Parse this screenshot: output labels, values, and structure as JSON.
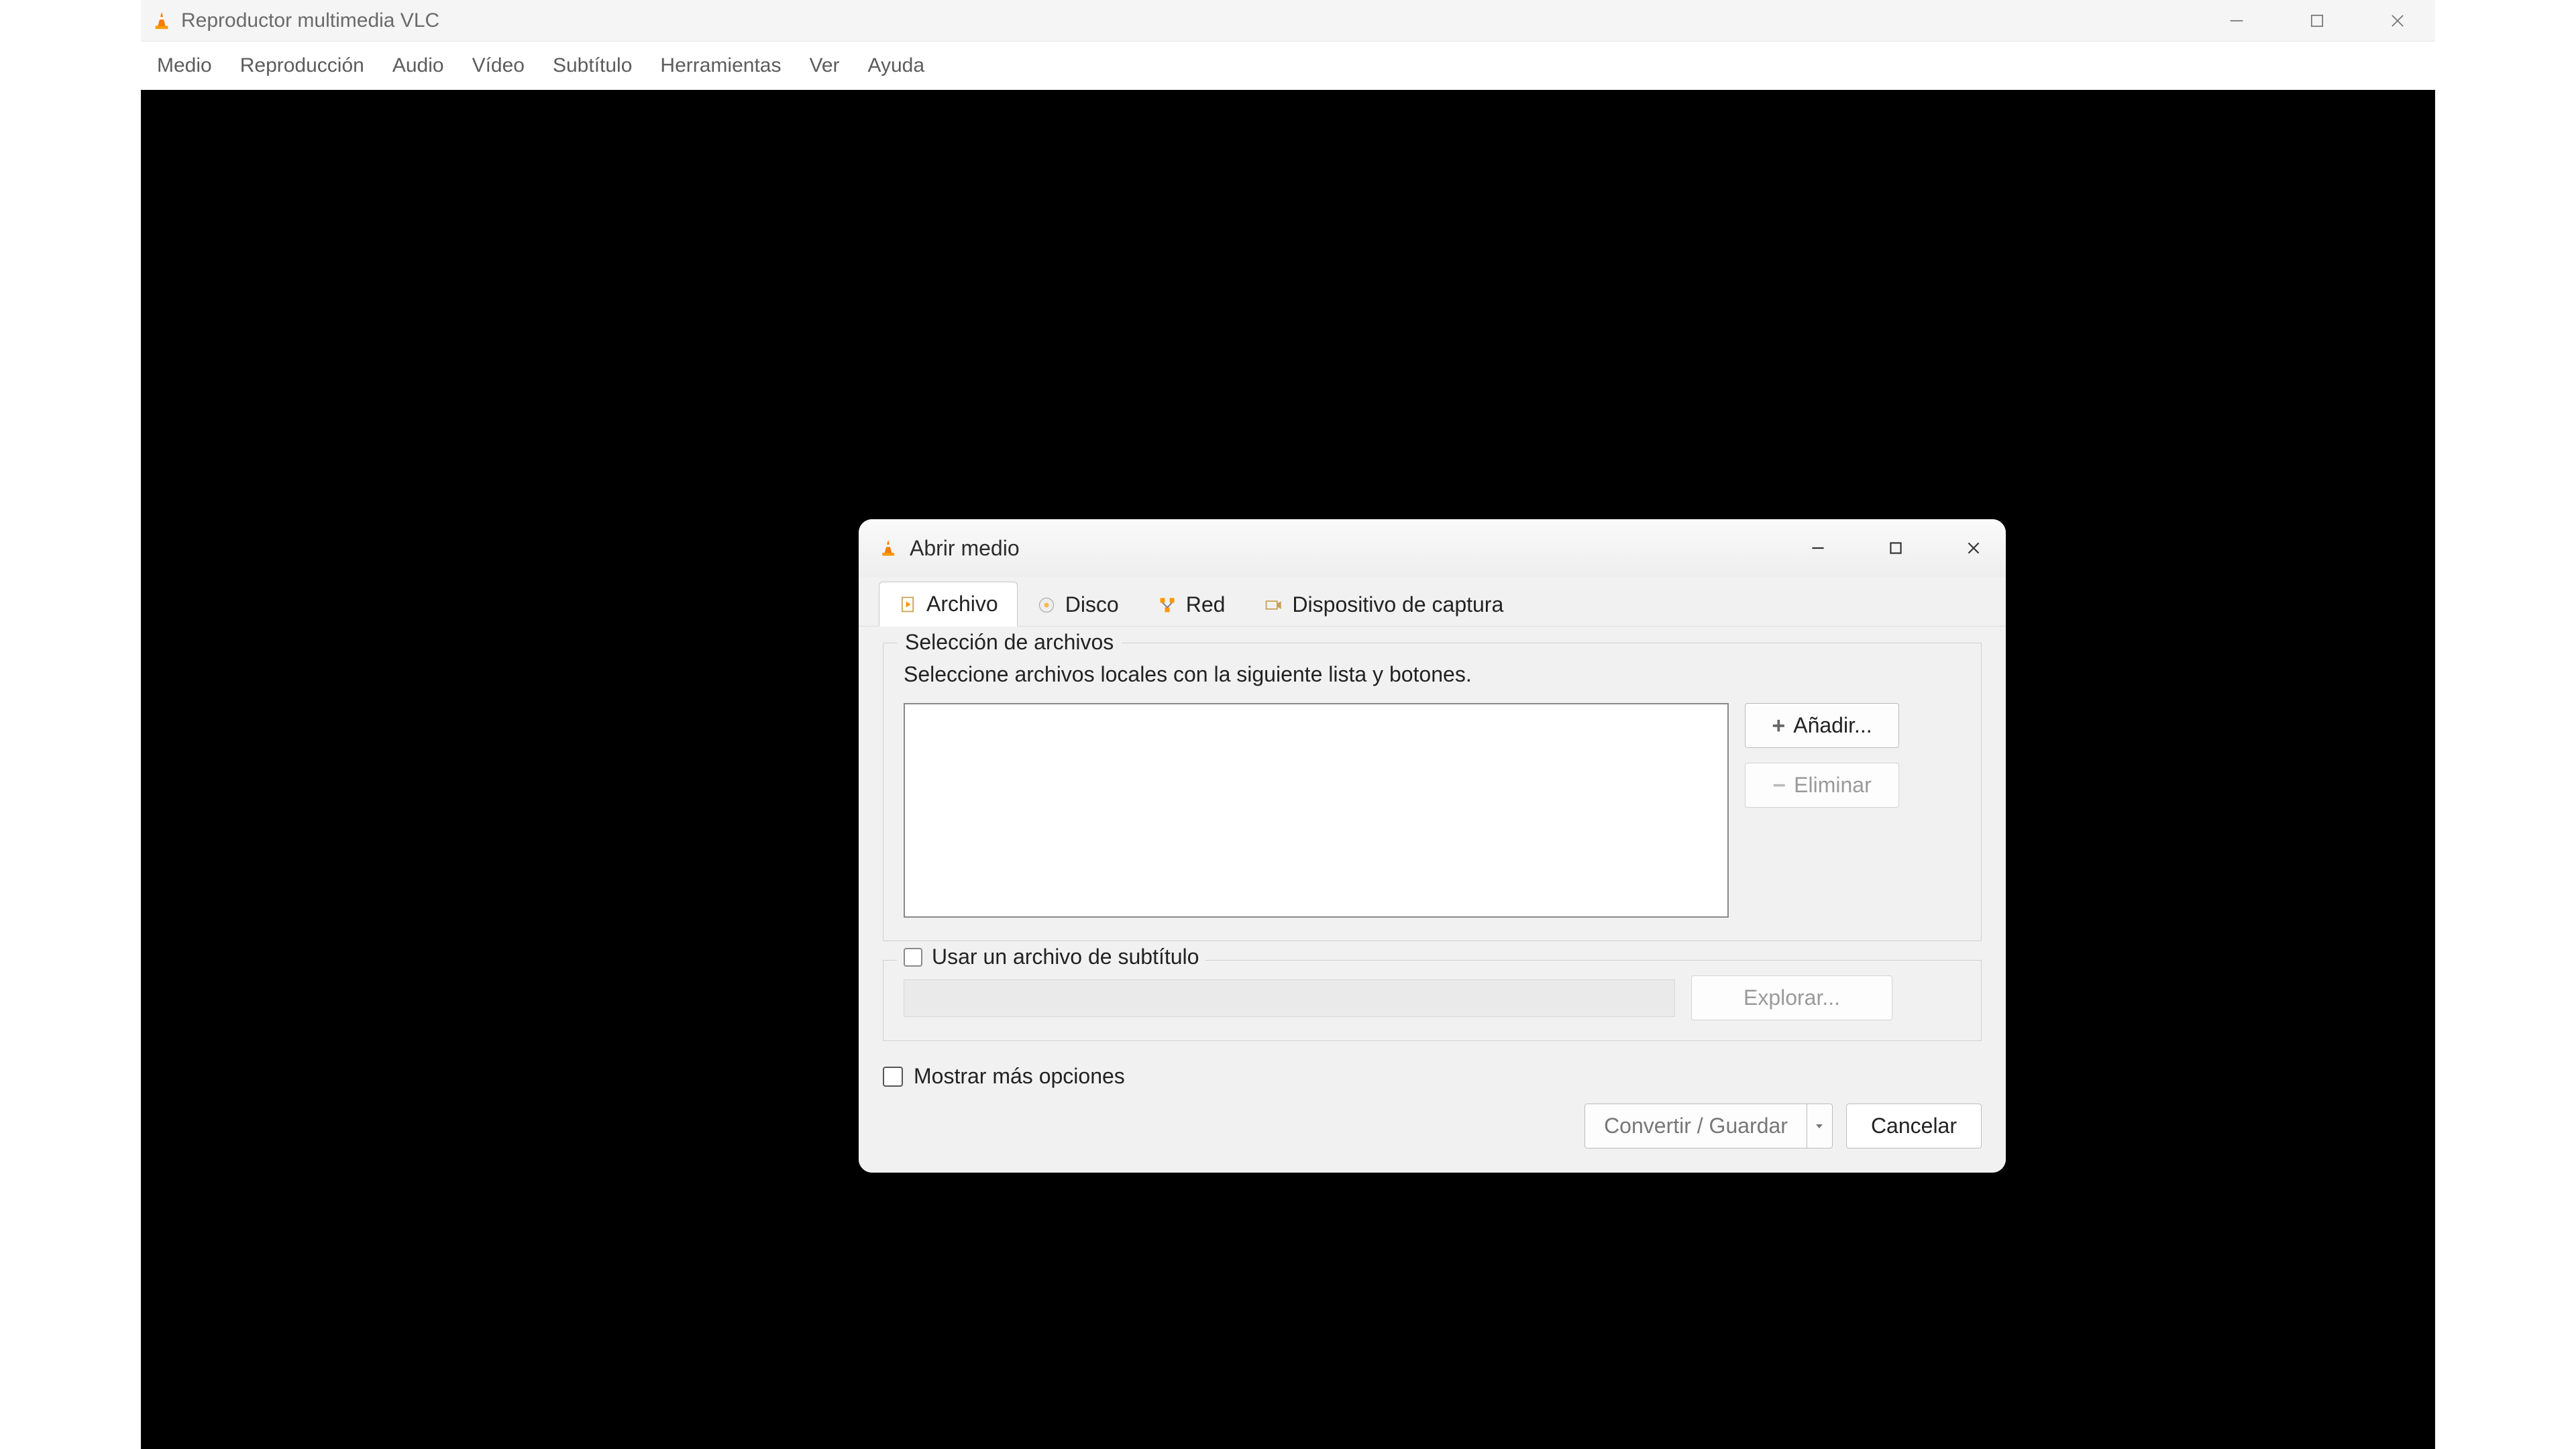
{
  "app": {
    "title": "Reproductor multimedia VLC"
  },
  "menubar": {
    "items": [
      "Medio",
      "Reproducción",
      "Audio",
      "Vídeo",
      "Subtítulo",
      "Herramientas",
      "Ver",
      "Ayuda"
    ]
  },
  "dialog": {
    "title": "Abrir medio",
    "tabs": {
      "file": "Archivo",
      "disc": "Disco",
      "network": "Red",
      "capture": "Dispositivo de captura"
    },
    "file_selection": {
      "legend": "Selección de archivos",
      "hint": "Seleccione archivos locales con la siguiente lista y botones.",
      "add": "Añadir...",
      "remove": "Eliminar"
    },
    "subtitle": {
      "checkbox_label": "Usar un archivo de subtítulo",
      "browse": "Explorar..."
    },
    "more_options": "Mostrar más opciones",
    "convert_save": "Convertir / Guardar",
    "cancel": "Cancelar"
  }
}
